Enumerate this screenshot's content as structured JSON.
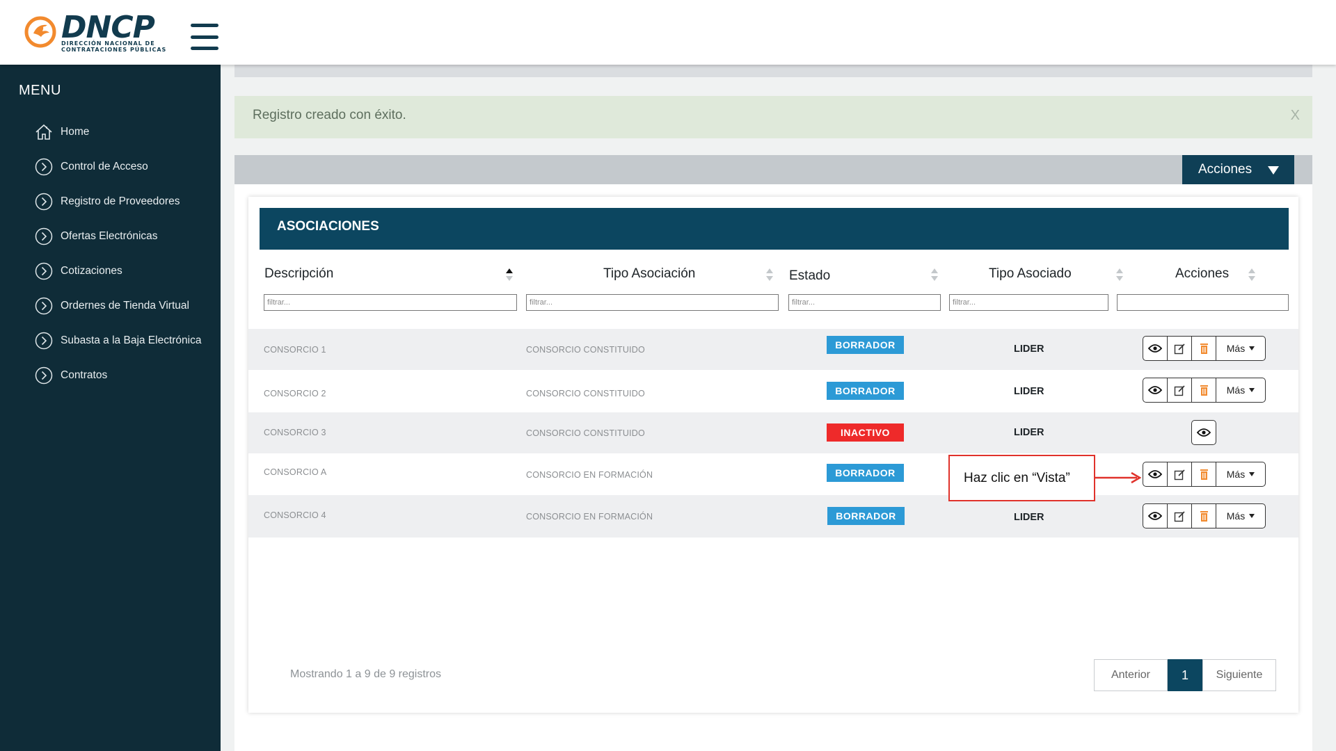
{
  "brand": {
    "name": "DNCP",
    "subtitle": "DIRECCIÓN NACIONAL DE CONTRATACIONES PÚBLICAS",
    "accent": "#f28a2e",
    "primary": "#0c4660"
  },
  "sidebar": {
    "title": "MENU",
    "items": [
      {
        "label": "Home",
        "icon": "home-icon"
      },
      {
        "label": "Control de Acceso",
        "icon": "chevron-right-circle-icon"
      },
      {
        "label": "Registro de Proveedores",
        "icon": "chevron-right-circle-icon"
      },
      {
        "label": "Ofertas Electrónicas",
        "icon": "chevron-right-circle-icon"
      },
      {
        "label": "Cotizaciones",
        "icon": "chevron-right-circle-icon"
      },
      {
        "label": "Ordernes de Tienda Virtual",
        "icon": "chevron-right-circle-icon"
      },
      {
        "label": "Subasta a la Baja Electrónica",
        "icon": "chevron-right-circle-icon"
      },
      {
        "label": "Contratos",
        "icon": "chevron-right-circle-icon"
      }
    ]
  },
  "alert": {
    "message": "Registro creado con éxito.",
    "close": "X"
  },
  "toolbar": {
    "actions_label": "Acciones"
  },
  "table": {
    "title": "ASOCIACIONES",
    "columns": [
      "Descripción",
      "Tipo Asociación",
      "Estado",
      "Tipo Asociado",
      "Acciones"
    ],
    "sorted_column": "Descripción",
    "filter_placeholder": "filtrar...",
    "rows": [
      {
        "descripcion": "CONSORCIO 1",
        "tipo_asociacion": "CONSORCIO CONSTITUIDO",
        "estado": "BORRADOR",
        "tipo_asociado": "LIDER",
        "acciones": "full"
      },
      {
        "descripcion": "CONSORCIO 2",
        "tipo_asociacion": "CONSORCIO CONSTITUIDO",
        "estado": "BORRADOR",
        "tipo_asociado": "LIDER",
        "acciones": "full"
      },
      {
        "descripcion": "CONSORCIO 3",
        "tipo_asociacion": "CONSORCIO CONSTITUIDO",
        "estado": "INACTIVO",
        "tipo_asociado": "LIDER",
        "acciones": "view"
      },
      {
        "descripcion": "CONSORCIO A",
        "tipo_asociacion": "CONSORCIO EN FORMACIÓN",
        "estado": "BORRADOR",
        "tipo_asociado": "",
        "acciones": "full"
      },
      {
        "descripcion": "CONSORCIO 4",
        "tipo_asociacion": "CONSORCIO EN FORMACIÓN",
        "estado": "BORRADOR",
        "tipo_asociado": "LIDER",
        "acciones": "full"
      }
    ],
    "mas_label": "Más",
    "status_colors": {
      "BORRADOR": "#2c9ad6",
      "INACTIVO": "#ee2a2a"
    },
    "info": "Mostrando 1 a 9 de 9 registros",
    "pagination": {
      "prev": "Anterior",
      "current": "1",
      "next": "Siguiente"
    }
  },
  "callout": {
    "text": "Haz clic en “Vista”",
    "color": "#e0322b"
  }
}
